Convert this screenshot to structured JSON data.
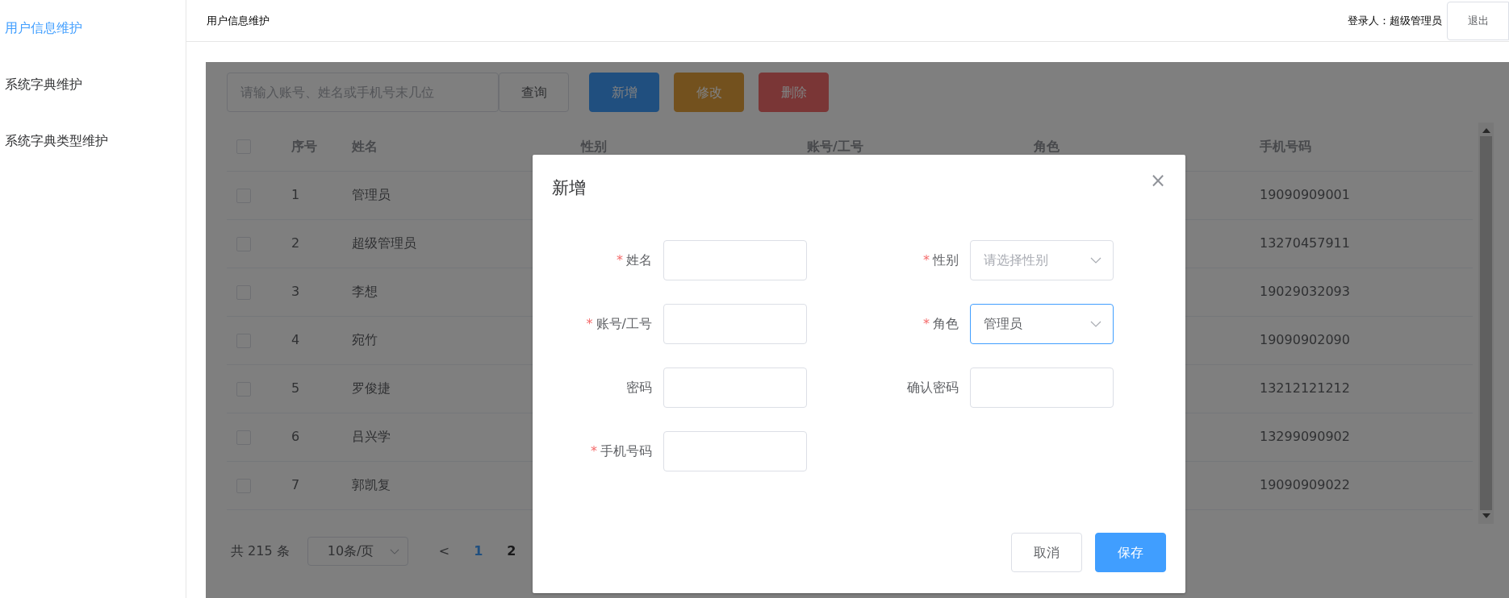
{
  "sidebar": {
    "items": [
      {
        "label": "用户信息维护",
        "selected": true
      },
      {
        "label": "系统字典维护",
        "selected": false
      },
      {
        "label": "系统字典类型维护",
        "selected": false
      }
    ]
  },
  "header": {
    "title": "用户信息维护",
    "login_label": "登录人：超级管理员",
    "logout_button": "退出"
  },
  "toolbar": {
    "search": {
      "placeholder": "请输入账号、姓名或手机号末几位"
    },
    "buttons": [
      {
        "label": "查询",
        "kind": "plain"
      },
      {
        "label": "新增",
        "kind": "primary"
      },
      {
        "label": "修改",
        "kind": "warning"
      },
      {
        "label": "删除",
        "kind": "danger"
      }
    ]
  },
  "table": {
    "select_all_checked": false,
    "columns": [
      "序号",
      "姓名",
      "性别",
      "账号/工号",
      "角色",
      "手机号码"
    ],
    "rows": [
      {
        "checked": false,
        "cells": [
          "1",
          "管理员",
          "",
          "",
          "",
          "19090909001"
        ]
      },
      {
        "checked": false,
        "cells": [
          "2",
          "超级管理员",
          "",
          "",
          "",
          "13270457911"
        ]
      },
      {
        "checked": false,
        "cells": [
          "3",
          "李想",
          "",
          "",
          "",
          "19029032093"
        ]
      },
      {
        "checked": false,
        "cells": [
          "4",
          "宛竹",
          "",
          "",
          "",
          "19090902090"
        ]
      },
      {
        "checked": false,
        "cells": [
          "5",
          "罗俊捷",
          "",
          "",
          "",
          "13212121212"
        ]
      },
      {
        "checked": false,
        "cells": [
          "6",
          "吕兴学",
          "",
          "",
          "",
          "13299090902"
        ]
      },
      {
        "checked": false,
        "cells": [
          "7",
          "郭凯复",
          "",
          "",
          "",
          "19090909022"
        ]
      }
    ]
  },
  "pagination": {
    "total": "共 215 条",
    "page_size": "10条/页",
    "prev": "<",
    "pages": [
      {
        "label": "1",
        "selected": true
      },
      {
        "label": "2",
        "selected": false
      }
    ]
  },
  "dialog": {
    "title": "新增",
    "close": "×",
    "fields": [
      {
        "required_mark": "*",
        "label": "姓名",
        "kind": "input",
        "focused": false
      },
      {
        "required_mark": "*",
        "label": "性别",
        "kind": "select",
        "placeholder": "请选择性别",
        "focused": false
      },
      {
        "required_mark": "*",
        "label": "账号/工号",
        "kind": "input",
        "focused": false
      },
      {
        "required_mark": "*",
        "label": "角色",
        "kind": "select",
        "value": "管理员",
        "focused": true
      },
      {
        "label": "密码",
        "kind": "input",
        "focused": false
      },
      {
        "label": "确认密码",
        "kind": "input",
        "focused": false
      },
      {
        "required_mark": "*",
        "label": "手机号码",
        "kind": "input",
        "focused": false
      }
    ],
    "buttons": [
      {
        "label": "取消",
        "kind": "plain"
      },
      {
        "label": "保存",
        "kind": "primary"
      }
    ]
  }
}
